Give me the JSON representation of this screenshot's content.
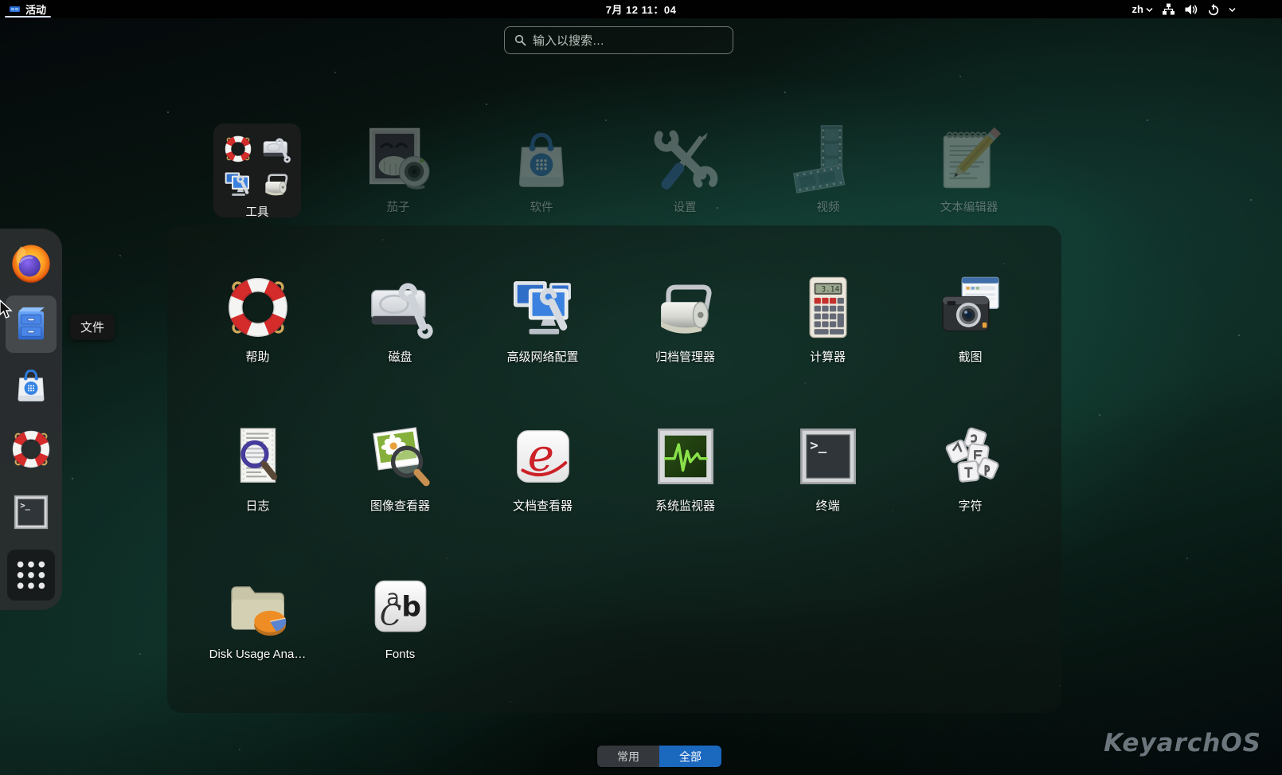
{
  "topbar": {
    "activities_label": "活动",
    "clock": "7月 12 11：04",
    "input_method_label": "zh"
  },
  "search": {
    "placeholder": "输入以搜索…"
  },
  "top_row": {
    "folder_label": "工具",
    "folder_mini_icons": [
      "lifebuoy",
      "disk-wrench",
      "network-monitors",
      "archive-roller"
    ],
    "apps": [
      {
        "label": "茄子",
        "icon": "cheese-webcam"
      },
      {
        "label": "软件",
        "icon": "software-bag"
      },
      {
        "label": "设置",
        "icon": "settings-tools"
      },
      {
        "label": "视频",
        "icon": "videos-filmstrip"
      },
      {
        "label": "文本编辑器",
        "icon": "text-editor-notepad"
      }
    ]
  },
  "folder_apps": [
    {
      "label": "帮助",
      "icon": "lifebuoy"
    },
    {
      "label": "磁盘",
      "icon": "disk-wrench"
    },
    {
      "label": "高级网络配置",
      "icon": "network-monitors"
    },
    {
      "label": "归档管理器",
      "icon": "archive-roller"
    },
    {
      "label": "计算器",
      "icon": "calculator"
    },
    {
      "label": "截图",
      "icon": "camera-window"
    },
    {
      "label": "日志",
      "icon": "document-magnifier"
    },
    {
      "label": "图像查看器",
      "icon": "photo-magnifier"
    },
    {
      "label": "文档查看器",
      "icon": "evince-e"
    },
    {
      "label": "系统监视器",
      "icon": "heartbeat-monitor"
    },
    {
      "label": "终端",
      "icon": "terminal"
    },
    {
      "label": "字符",
      "icon": "keycaps"
    },
    {
      "label": "Disk Usage Ana…",
      "icon": "folder-piechart"
    },
    {
      "label": "Fonts",
      "icon": "fonts-abc"
    }
  ],
  "dock": {
    "tooltip": "文件",
    "icons": [
      "firefox",
      "files-cabinet",
      "software-bag",
      "lifebuoy",
      "terminal",
      "show-apps-grid"
    ]
  },
  "footer": {
    "frequent_label": "常用",
    "all_label": "全部",
    "selected": "全部"
  },
  "watermark": "KeyarchOS",
  "icon_glyphs": {
    "terminal_prompt": ">_",
    "evince_e": "e",
    "fonts_a": "a",
    "fonts_b": "b",
    "fonts_c": "C",
    "calculator_display": "3.14"
  },
  "colors": {
    "accent_blue": "#1b68bf",
    "topbar_bg": "#010101",
    "panel_bg": "rgba(15,23,20,0.52)",
    "selected_tile_bg": "rgba(28,28,28,0.92)"
  }
}
